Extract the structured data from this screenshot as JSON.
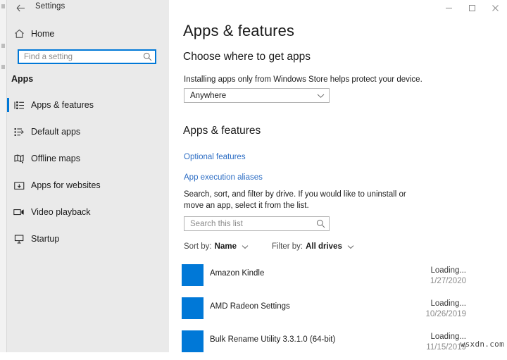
{
  "window": {
    "title": "Settings",
    "back_icon": "back-arrow-icon",
    "controls": {
      "minimize": "minimize-icon",
      "maximize": "maximize-icon",
      "close": "close-icon"
    }
  },
  "colors": {
    "accent": "#0078d7",
    "sidebar_bg": "#eaeaea",
    "link": "#2c6dc4",
    "app_tile": "#0078d7"
  },
  "sidebar": {
    "home_label": "Home",
    "home_icon": "home-icon",
    "search": {
      "placeholder": "Find a setting",
      "value": "",
      "icon": "search-icon"
    },
    "section_title": "Apps",
    "items": [
      {
        "label": "Apps & features",
        "icon": "list-features-icon",
        "selected": true
      },
      {
        "label": "Default apps",
        "icon": "default-apps-icon",
        "selected": false
      },
      {
        "label": "Offline maps",
        "icon": "offline-maps-icon",
        "selected": false
      },
      {
        "label": "Apps for websites",
        "icon": "apps-for-websites-icon",
        "selected": false
      },
      {
        "label": "Video playback",
        "icon": "video-playback-icon",
        "selected": false
      },
      {
        "label": "Startup",
        "icon": "startup-icon",
        "selected": false
      }
    ]
  },
  "main": {
    "page_title": "Apps & features",
    "choose_heading": "Choose where to get apps",
    "choose_description": "Installing apps only from Windows Store helps protect your device.",
    "source_dropdown": {
      "value": "Anywhere",
      "chevron": "chevron-down-icon"
    },
    "apps_heading": "Apps & features",
    "links": [
      {
        "label": "Optional features"
      },
      {
        "label": "App execution aliases"
      }
    ],
    "list_description": "Search, sort, and filter by drive. If you would like to uninstall or move an app, select it from the list.",
    "list_search": {
      "placeholder": "Search this list",
      "value": "",
      "icon": "search-icon"
    },
    "filters": {
      "sort_label": "Sort by:",
      "sort_value": "Name",
      "filter_label": "Filter by:",
      "filter_value": "All drives",
      "chevron": "chevron-down-icon"
    },
    "apps": [
      {
        "name": "Amazon Kindle",
        "status": "Loading...",
        "date": "1/27/2020"
      },
      {
        "name": "AMD Radeon Settings",
        "status": "Loading...",
        "date": "10/26/2019"
      },
      {
        "name": "Bulk Rename Utility 3.3.1.0 (64-bit)",
        "status": "Loading...",
        "date": "11/15/2019"
      }
    ]
  },
  "watermark": "wsxdn.com"
}
